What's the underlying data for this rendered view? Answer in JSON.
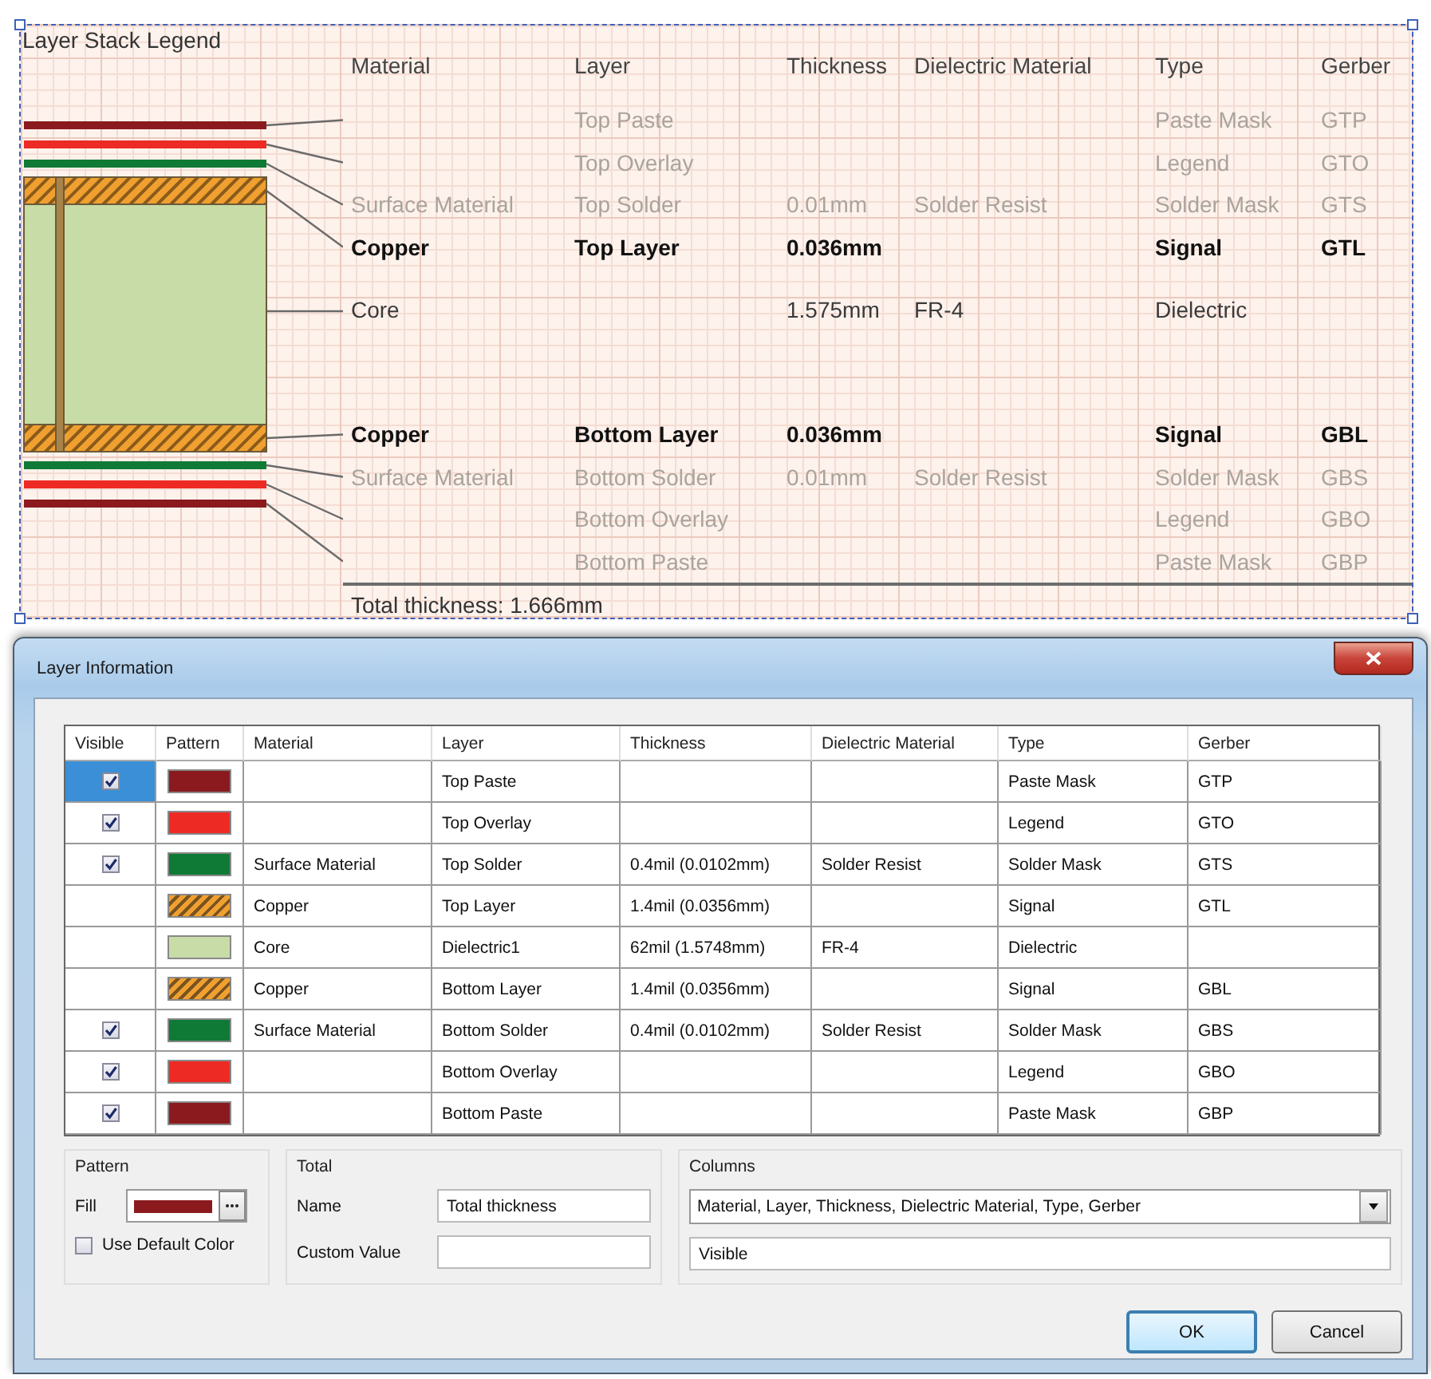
{
  "legend": {
    "title": "Layer Stack Legend",
    "columns": [
      "Material",
      "Layer",
      "Thickness",
      "Dielectric Material",
      "Type",
      "Gerber"
    ],
    "rows": [
      {
        "kind": "mask",
        "layer": "Top Paste",
        "type": "Paste Mask",
        "gerber": "GTP"
      },
      {
        "kind": "mask",
        "layer": "Top Overlay",
        "type": "Legend",
        "gerber": "GTO"
      },
      {
        "kind": "mask",
        "material": "Surface Material",
        "layer": "Top Solder",
        "thickness": "0.01mm",
        "dielectric": "Solder Resist",
        "type": "Solder Mask",
        "gerber": "GTS"
      },
      {
        "kind": "signal",
        "material": "Copper",
        "layer": "Top Layer",
        "thickness": "0.036mm",
        "type": "Signal",
        "gerber": "GTL"
      },
      {
        "kind": "core",
        "material": "Core",
        "thickness": "1.575mm",
        "dielectric": "FR-4",
        "type": "Dielectric"
      },
      {
        "kind": "signal",
        "material": "Copper",
        "layer": "Bottom Layer",
        "thickness": "0.036mm",
        "type": "Signal",
        "gerber": "GBL"
      },
      {
        "kind": "mask",
        "material": "Surface Material",
        "layer": "Bottom Solder",
        "thickness": "0.01mm",
        "dielectric": "Solder Resist",
        "type": "Solder Mask",
        "gerber": "GBS"
      },
      {
        "kind": "mask",
        "layer": "Bottom Overlay",
        "type": "Legend",
        "gerber": "GBO"
      },
      {
        "kind": "mask",
        "layer": "Bottom Paste",
        "type": "Paste Mask",
        "gerber": "GBP"
      }
    ],
    "total": "Total thickness: 1.666mm"
  },
  "dialog": {
    "title": "Layer Information",
    "table": {
      "columns": [
        "Visible",
        "Pattern",
        "Material",
        "Layer",
        "Thickness",
        "Dielectric Material",
        "Type",
        "Gerber"
      ],
      "rows": [
        {
          "selected": true,
          "visible": true,
          "pattern": {
            "kind": "solid",
            "color": "#8b1a1f"
          },
          "layer": "Top Paste",
          "type": "Paste Mask",
          "gerber": "GTP"
        },
        {
          "selected": false,
          "visible": true,
          "pattern": {
            "kind": "solid",
            "color": "#ee2a24"
          },
          "layer": "Top Overlay",
          "type": "Legend",
          "gerber": "GTO"
        },
        {
          "selected": false,
          "visible": true,
          "pattern": {
            "kind": "solid",
            "color": "#0f7a35"
          },
          "material": "Surface Material",
          "layer": "Top Solder",
          "thickness": "0.4mil (0.0102mm)",
          "dielectric": "Solder Resist",
          "type": "Solder Mask",
          "gerber": "GTS"
        },
        {
          "selected": false,
          "pattern": {
            "kind": "hatched",
            "color": "#f0a030"
          },
          "material": "Copper",
          "layer": "Top Layer",
          "thickness": "1.4mil (0.0356mm)",
          "type": "Signal",
          "gerber": "GTL"
        },
        {
          "selected": false,
          "pattern": {
            "kind": "solid",
            "color": "#c8dca8"
          },
          "material": "Core",
          "layer": "Dielectric1",
          "thickness": "62mil (1.5748mm)",
          "dielectric": "FR-4",
          "type": "Dielectric"
        },
        {
          "selected": false,
          "pattern": {
            "kind": "hatched",
            "color": "#f0a030"
          },
          "material": "Copper",
          "layer": "Bottom Layer",
          "thickness": "1.4mil (0.0356mm)",
          "type": "Signal",
          "gerber": "GBL"
        },
        {
          "selected": false,
          "visible": true,
          "pattern": {
            "kind": "solid",
            "color": "#0f7a35"
          },
          "material": "Surface Material",
          "layer": "Bottom Solder",
          "thickness": "0.4mil (0.0102mm)",
          "dielectric": "Solder Resist",
          "type": "Solder Mask",
          "gerber": "GBS"
        },
        {
          "selected": false,
          "visible": true,
          "pattern": {
            "kind": "solid",
            "color": "#ee2a24"
          },
          "layer": "Bottom Overlay",
          "type": "Legend",
          "gerber": "GBO"
        },
        {
          "selected": false,
          "visible": true,
          "pattern": {
            "kind": "solid",
            "color": "#8b1a1f"
          },
          "layer": "Bottom Paste",
          "type": "Paste Mask",
          "gerber": "GBP"
        }
      ]
    },
    "pattern_group": {
      "label": "Pattern",
      "fill_label": "Fill",
      "default_color": {
        "label": "Use Default Color",
        "checked": false
      }
    },
    "total_group": {
      "label": "Total",
      "name_label": "Name",
      "name_value": "Total thickness",
      "custom_label": "Custom Value"
    },
    "columns_group": {
      "label": "Columns",
      "value": "Material, Layer, Thickness, Dielectric Material, Type, Gerber",
      "extra": "Visible"
    },
    "buttons": [
      {
        "label": "OK",
        "default": true
      },
      {
        "label": "Cancel",
        "default": false
      }
    ]
  }
}
